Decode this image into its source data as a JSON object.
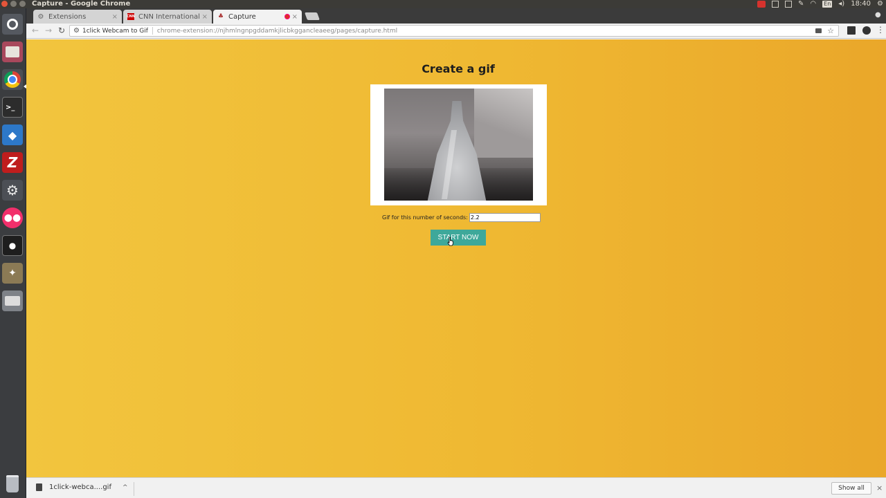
{
  "window": {
    "title": "Capture - Google Chrome"
  },
  "tray": {
    "language": "En",
    "time": "18:40"
  },
  "tabs": [
    {
      "label": "Extensions",
      "close": "×"
    },
    {
      "label": "CNN International",
      "close": "×",
      "favicon_text": "CNN"
    },
    {
      "label": "Capture",
      "close": "×"
    }
  ],
  "omnibox": {
    "extension_name": "1click Webcam to Gif",
    "url": "chrome-extension://njhmlngnpgddamkjlicbkggancleaeeg/pages/capture.html"
  },
  "icons": {
    "puzzle": "⚙",
    "back": "←",
    "forward": "→",
    "reload": "↻",
    "star": "☆",
    "menu": "⋮",
    "chevron_up": "^",
    "close": "×",
    "profile": "●"
  },
  "page": {
    "title": "Create a gif",
    "seconds_label": "Gif for this number of seconds:",
    "seconds_value": "2.2",
    "start_label": "START NOW"
  },
  "downloads": {
    "file_name": "1click-webca....gif",
    "show_all_label": "Show all"
  },
  "colors": {
    "page_background": "#f0bd36",
    "start_button": "#3ea89a"
  }
}
